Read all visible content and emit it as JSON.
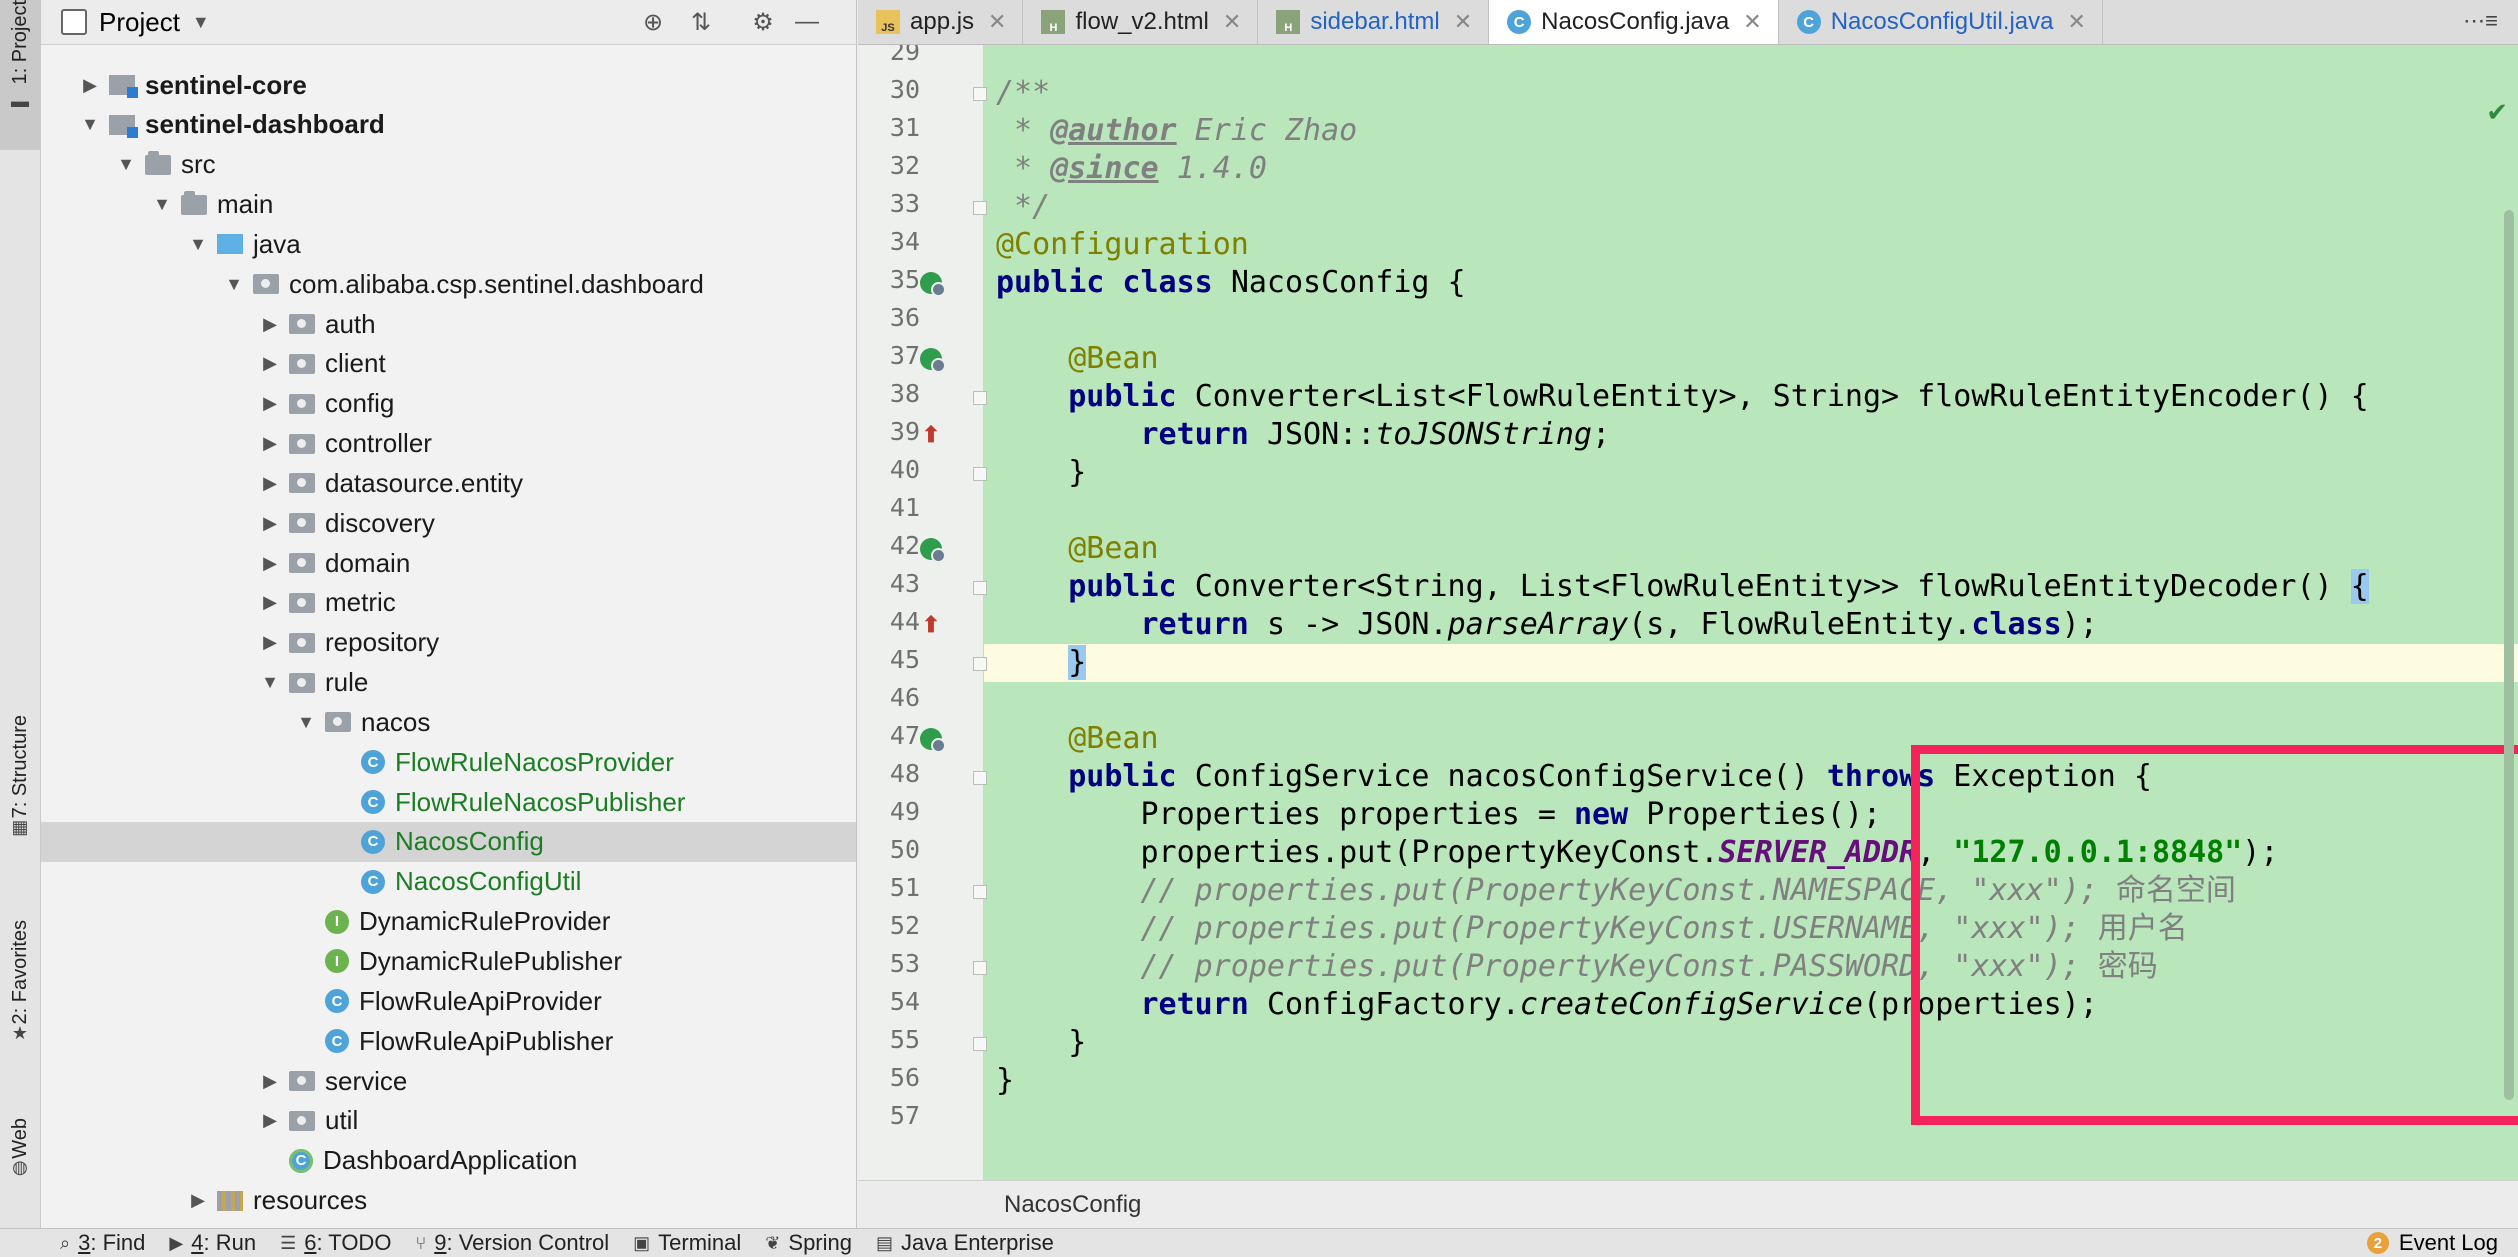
{
  "left_stripe": {
    "project_label": "1: Project",
    "structure_label": "7: Structure",
    "favorites_label": "2: Favorites",
    "web_label": "Web"
  },
  "project_panel": {
    "title": "Project",
    "tree": [
      {
        "label": "sentinel-core",
        "icon": "module-folder-icon",
        "expanded": false,
        "bold": true
      },
      {
        "label": "sentinel-dashboard",
        "icon": "module-folder-icon",
        "expanded": true,
        "bold": true
      },
      {
        "label": "src",
        "icon": "folder-icon",
        "expanded": true
      },
      {
        "label": "main",
        "icon": "folder-icon",
        "expanded": true
      },
      {
        "label": "java",
        "icon": "source-root-icon",
        "expanded": true
      },
      {
        "label": "com.alibaba.csp.sentinel.dashboard",
        "icon": "package-icon",
        "expanded": true
      },
      {
        "label": "auth",
        "icon": "package-icon",
        "expanded": false
      },
      {
        "label": "client",
        "icon": "package-icon",
        "expanded": false
      },
      {
        "label": "config",
        "icon": "package-icon",
        "expanded": false
      },
      {
        "label": "controller",
        "icon": "package-icon",
        "expanded": false
      },
      {
        "label": "datasource.entity",
        "icon": "package-icon",
        "expanded": false
      },
      {
        "label": "discovery",
        "icon": "package-icon",
        "expanded": false
      },
      {
        "label": "domain",
        "icon": "package-icon",
        "expanded": false
      },
      {
        "label": "metric",
        "icon": "package-icon",
        "expanded": false
      },
      {
        "label": "repository",
        "icon": "package-icon",
        "expanded": false
      },
      {
        "label": "rule",
        "icon": "package-icon",
        "expanded": true
      },
      {
        "label": "nacos",
        "icon": "package-icon",
        "expanded": true
      },
      {
        "label": "FlowRuleNacosProvider",
        "icon": "class-icon"
      },
      {
        "label": "FlowRuleNacosPublisher",
        "icon": "class-icon"
      },
      {
        "label": "NacosConfig",
        "icon": "class-icon",
        "selected": true
      },
      {
        "label": "NacosConfigUtil",
        "icon": "class-icon"
      },
      {
        "label": "DynamicRuleProvider",
        "icon": "interface-icon"
      },
      {
        "label": "DynamicRulePublisher",
        "icon": "interface-icon"
      },
      {
        "label": "FlowRuleApiProvider",
        "icon": "class-icon"
      },
      {
        "label": "FlowRuleApiPublisher",
        "icon": "class-icon"
      },
      {
        "label": "service",
        "icon": "package-icon",
        "expanded": false
      },
      {
        "label": "util",
        "icon": "package-icon",
        "expanded": false
      },
      {
        "label": "DashboardApplication",
        "icon": "spring-app-class-icon"
      },
      {
        "label": "resources",
        "icon": "resources-folder-icon",
        "expanded": false
      }
    ]
  },
  "tabs": [
    {
      "label": "app.js",
      "icon": "js-file-icon",
      "icon_text": "JS"
    },
    {
      "label": "flow_v2.html",
      "icon": "html-file-icon",
      "icon_text": "H"
    },
    {
      "label": "sidebar.html",
      "icon": "html-file-icon",
      "icon_text": "H"
    },
    {
      "label": "NacosConfig.java",
      "icon": "java-class-icon",
      "icon_text": "C",
      "active": true
    },
    {
      "label": "NacosConfigUtil.java",
      "icon": "java-class-icon",
      "icon_text": "C"
    }
  ],
  "editor": {
    "first_line": 29,
    "current_line": 45,
    "lines": [
      {
        "n": 29,
        "segs": []
      },
      {
        "n": 30,
        "segs": [
          [
            "cmt",
            "/**"
          ]
        ]
      },
      {
        "n": 31,
        "segs": [
          [
            "cmt",
            " * "
          ],
          [
            "tag",
            "@author"
          ],
          [
            "cmt",
            " Eric Zhao"
          ]
        ]
      },
      {
        "n": 32,
        "segs": [
          [
            "cmt",
            " * "
          ],
          [
            "tag",
            "@since"
          ],
          [
            "cmt",
            " 1.4.0"
          ]
        ]
      },
      {
        "n": 33,
        "segs": [
          [
            "cmt",
            " */"
          ]
        ]
      },
      {
        "n": 34,
        "segs": [
          [
            "ann",
            "@Configuration"
          ]
        ]
      },
      {
        "n": 35,
        "segs": [
          [
            "kw",
            "public class "
          ],
          [
            "",
            "NacosConfig {"
          ]
        ]
      },
      {
        "n": 36,
        "segs": []
      },
      {
        "n": 37,
        "segs": [
          [
            "",
            "    "
          ],
          [
            "ann",
            "@Bean"
          ]
        ]
      },
      {
        "n": 38,
        "segs": [
          [
            "",
            "    "
          ],
          [
            "kw",
            "public "
          ],
          [
            "",
            "Converter<List<FlowRuleEntity>, String> flowRuleEntityEncoder() {"
          ]
        ]
      },
      {
        "n": 39,
        "segs": [
          [
            "",
            "        "
          ],
          [
            "kw",
            "return "
          ],
          [
            "",
            "JSON::"
          ],
          [
            "ital",
            "toJSONString"
          ],
          [
            "",
            ";"
          ]
        ]
      },
      {
        "n": 40,
        "segs": [
          [
            "",
            "    }"
          ]
        ]
      },
      {
        "n": 41,
        "segs": []
      },
      {
        "n": 42,
        "segs": [
          [
            "",
            "    "
          ],
          [
            "ann",
            "@Bean"
          ]
        ]
      },
      {
        "n": 43,
        "segs": [
          [
            "",
            "    "
          ],
          [
            "kw",
            "public "
          ],
          [
            "",
            "Converter<String, List<FlowRuleEntity>> flowRuleEntityDecoder() "
          ],
          [
            "brace-hl",
            "{"
          ]
        ]
      },
      {
        "n": 44,
        "segs": [
          [
            "",
            "        "
          ],
          [
            "kw",
            "return "
          ],
          [
            "",
            "s -> JSON."
          ],
          [
            "ital",
            "parseArray"
          ],
          [
            "",
            "(s, FlowRuleEntity."
          ],
          [
            "kw",
            "class"
          ],
          [
            "",
            ");"
          ]
        ]
      },
      {
        "n": 45,
        "segs": [
          [
            "",
            "    "
          ],
          [
            "brace-hl",
            "}"
          ]
        ]
      },
      {
        "n": 46,
        "segs": []
      },
      {
        "n": 47,
        "segs": [
          [
            "",
            "    "
          ],
          [
            "ann",
            "@Bean"
          ]
        ]
      },
      {
        "n": 48,
        "segs": [
          [
            "",
            "    "
          ],
          [
            "kw",
            "public "
          ],
          [
            "",
            "ConfigService nacosConfigService() "
          ],
          [
            "kw",
            "throws "
          ],
          [
            "",
            "Exception {"
          ]
        ]
      },
      {
        "n": 49,
        "segs": [
          [
            "",
            "        Properties properties = "
          ],
          [
            "kw",
            "new "
          ],
          [
            "",
            "Properties();"
          ]
        ]
      },
      {
        "n": 50,
        "segs": [
          [
            "",
            "        properties.put(PropertyKeyConst."
          ],
          [
            "sfield",
            "SERVER_ADDR"
          ],
          [
            "",
            ", "
          ],
          [
            "str",
            "\"127.0.0.1:8848\""
          ],
          [
            "",
            ");"
          ]
        ]
      },
      {
        "n": 51,
        "segs": [
          [
            "",
            "        "
          ],
          [
            "cmt",
            "// properties.put(PropertyKeyConst.NAMESPACE, \"xxx\"); "
          ],
          [
            "cmt cjk",
            "命名空间"
          ]
        ]
      },
      {
        "n": 52,
        "segs": [
          [
            "",
            "        "
          ],
          [
            "cmt",
            "// properties.put(PropertyKeyConst.USERNAME, \"xxx\"); "
          ],
          [
            "cmt cjk",
            "用户名"
          ]
        ]
      },
      {
        "n": 53,
        "segs": [
          [
            "",
            "        "
          ],
          [
            "cmt",
            "// properties.put(PropertyKeyConst.PASSWORD, \"xxx\"); "
          ],
          [
            "cmt cjk",
            "密码"
          ]
        ]
      },
      {
        "n": 54,
        "segs": [
          [
            "",
            "        "
          ],
          [
            "kw",
            "return "
          ],
          [
            "",
            "ConfigFactory."
          ],
          [
            "ital",
            "createConfigService"
          ],
          [
            "",
            "(properties);"
          ]
        ]
      },
      {
        "n": 55,
        "segs": [
          [
            "",
            "    }"
          ]
        ]
      },
      {
        "n": 56,
        "segs": [
          [
            "",
            "}"
          ]
        ]
      },
      {
        "n": 57,
        "segs": []
      }
    ],
    "gutter_marks": [
      {
        "line": 35,
        "type": "bean-class-icon"
      },
      {
        "line": 37,
        "type": "bean-method-icon"
      },
      {
        "line": 39,
        "type": "lambda-implements-icon"
      },
      {
        "line": 42,
        "type": "bean-method-icon"
      },
      {
        "line": 44,
        "type": "lambda-implements-icon"
      },
      {
        "line": 47,
        "type": "bean-method-icon"
      }
    ],
    "fold_lines": [
      30,
      33,
      38,
      40,
      43,
      45,
      48,
      51,
      53,
      55
    ],
    "breadcrumb": "NacosConfig",
    "highlight_color": "#f4245b",
    "background_color": "#b9e6bb"
  },
  "statusbar": {
    "items": [
      {
        "key": "3",
        "label": ": Find",
        "icon": "search-icon"
      },
      {
        "key": "4",
        "label": ": Run",
        "icon": "run-icon"
      },
      {
        "key": "6",
        "label": ": TODO",
        "icon": "todo-icon"
      },
      {
        "key": "9",
        "label": ": Version Control",
        "icon": "vcs-icon"
      },
      {
        "key": "",
        "label": "Terminal",
        "icon": "terminal-icon"
      },
      {
        "key": "",
        "label": "Spring",
        "icon": "spring-icon"
      },
      {
        "key": "",
        "label": "Java Enterprise",
        "icon": "java-enterprise-icon"
      }
    ],
    "event_log": {
      "label": "Event Log",
      "count": "2"
    }
  }
}
